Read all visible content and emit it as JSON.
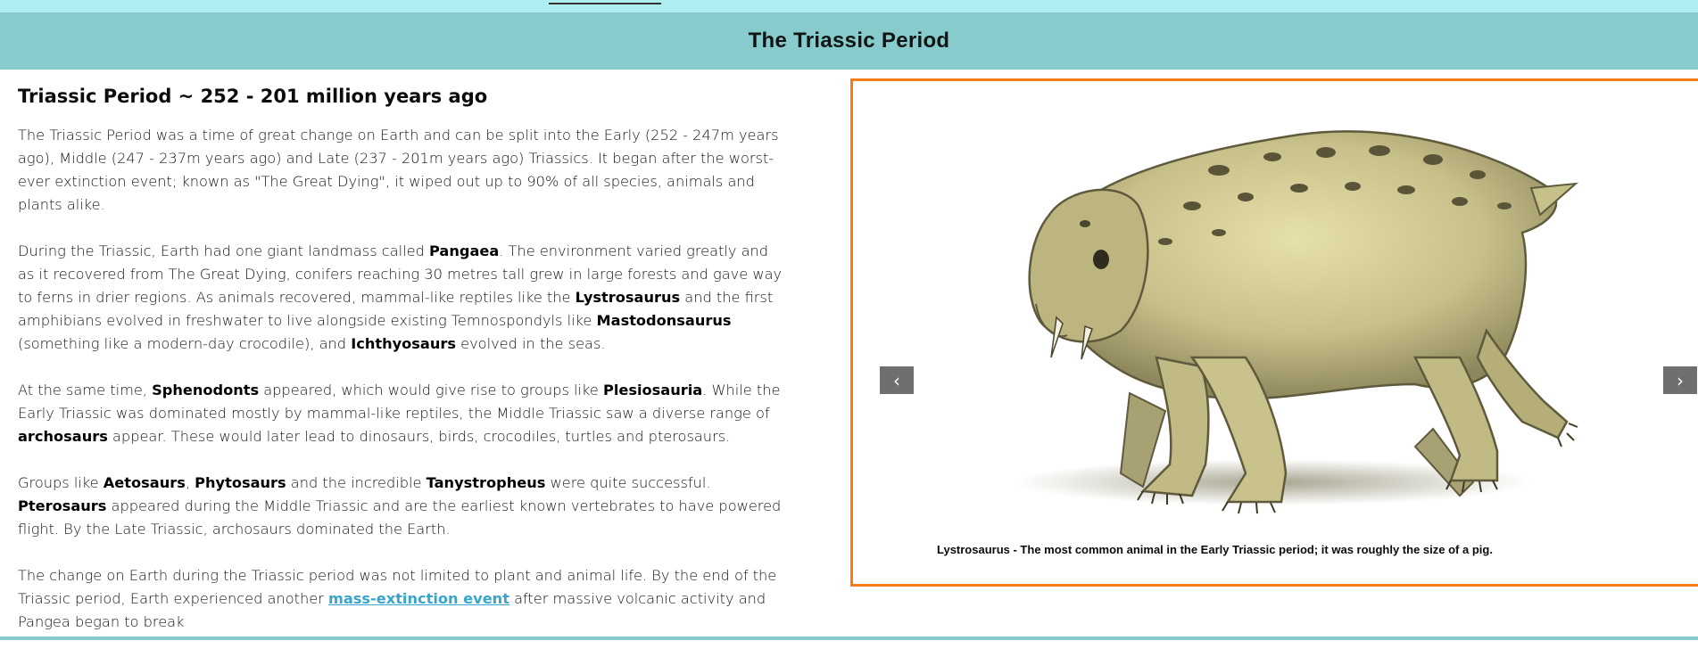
{
  "header": {
    "title": "The Triassic Period"
  },
  "article": {
    "title": "Triassic Period ~ 252 - 201 million years ago",
    "p1": "The Triassic Period was a time of great change on Earth and can be split into the Early (252 - 247m years ago), Middle (247 - 237m years ago) and Late (237 - 201m years ago) Triassics. It began after the worst-ever extinction event; known as \"The Great Dying\", it wiped out up to 90% of all species, animals and plants alike.",
    "p2": {
      "t1": "During the Triassic, Earth had one giant landmass called ",
      "b1": "Pangaea",
      "t2": ". The environment varied greatly and as it recovered from The Great Dying, conifers reaching 30 metres tall grew in large forests and gave way to ferns in drier regions. As animals recovered, mammal-like reptiles like the ",
      "b2": "Lystrosaurus",
      "t3": " and the first amphibians evolved in freshwater to live alongside existing Temnospondyls like ",
      "b3": "Mastodonsaurus",
      "t4": " (something like a modern-day crocodile), and ",
      "b4": "Ichthyosaurs",
      "t5": " evolved in the seas."
    },
    "p3": {
      "t1": "At the same time, ",
      "b1": "Sphenodonts",
      "t2": " appeared, which would give rise to groups like ",
      "b2": "Plesiosauria",
      "t3": ". While the Early Triassic was dominated mostly by mammal-like reptiles, the Middle Triassic saw a diverse range of ",
      "b3": "archosaurs",
      "t4": " appear. These would later lead to dinosaurs, birds, crocodiles, turtles and pterosaurs."
    },
    "p4": {
      "t1": "Groups like ",
      "b1": "Aetosaurs",
      "t2": ", ",
      "b2": "Phytosaurs",
      "t3": " and the incredible ",
      "b3": "Tanystropheus",
      "t4": " were quite successful. ",
      "b4": "Pterosaurs",
      "t5": " appeared during the Middle Triassic and are the earliest known vertebrates to have powered flight. By the Late Triassic, archosaurs dominated the Earth."
    },
    "p5": {
      "t1": "The change on Earth during the Triassic period was not limited to plant and animal life. By the end of the Triassic period, Earth experienced another ",
      "link": "mass-extinction event",
      "t2": " after massive volcanic activity and Pangea began to break"
    }
  },
  "carousel": {
    "caption": "Lystrosaurus - The most common animal in the Early Triassic period; it was roughly the size of a pig.",
    "prev_icon": "‹",
    "next_icon": "›",
    "prev_icon_name": "chevron-left-icon",
    "next_icon_name": "chevron-right-icon",
    "border_color": "#f57c16"
  },
  "colors": {
    "top_bar": "#aeeef0",
    "header_bg": "#88cbcc",
    "link": "#3aa5cc",
    "arrow_bg": "#6f6f6f"
  }
}
